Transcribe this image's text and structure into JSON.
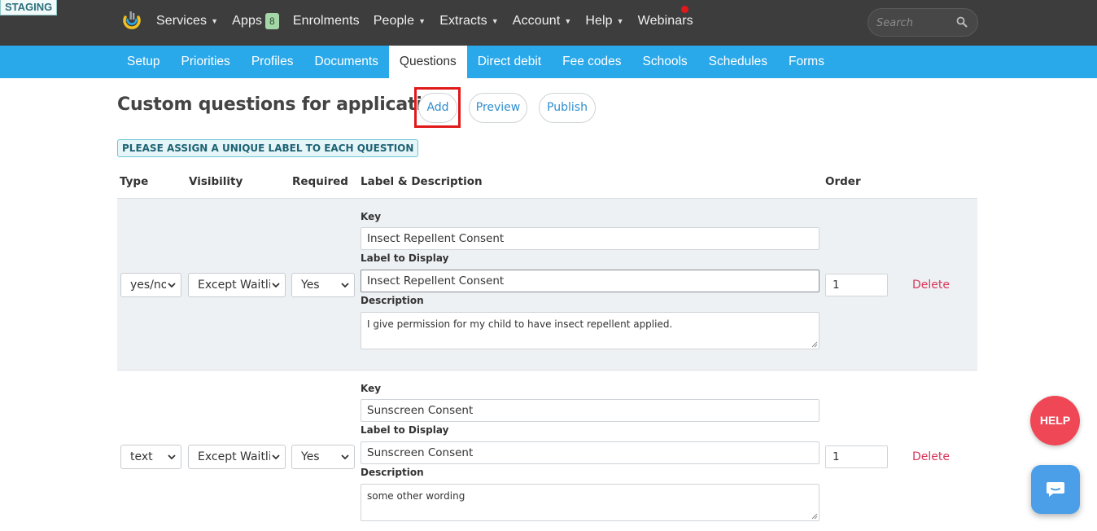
{
  "env_badge": "STAGING",
  "topnav": {
    "items": [
      {
        "label": "Services",
        "caret": true
      },
      {
        "label": "Apps",
        "caret": false,
        "badge": "8"
      },
      {
        "label": "Enrolments",
        "caret": false
      },
      {
        "label": "People",
        "caret": true
      },
      {
        "label": "Extracts",
        "caret": true
      },
      {
        "label": "Account",
        "caret": true
      },
      {
        "label": "Help",
        "caret": true
      },
      {
        "label": "Webinars",
        "caret": false
      }
    ],
    "search_placeholder": "Search"
  },
  "subnav": {
    "tabs": [
      "Setup",
      "Priorities",
      "Profiles",
      "Documents",
      "Questions",
      "Direct debit",
      "Fee codes",
      "Schools",
      "Schedules",
      "Forms"
    ],
    "active": "Questions"
  },
  "header": {
    "title": "Custom questions for application",
    "add_label": "Add",
    "preview_label": "Preview",
    "publish_label": "Publish"
  },
  "notice": "PLEASE ASSIGN A UNIQUE LABEL TO EACH QUESTION",
  "table": {
    "columns": {
      "type": "Type",
      "visibility": "Visibility",
      "required": "Required",
      "label_desc": "Label & Description",
      "order": "Order"
    },
    "field_labels": {
      "key": "Key",
      "label_to_display": "Label to Display",
      "description": "Description"
    },
    "rows": [
      {
        "type": "yes/no",
        "visibility": "Except Waitlist",
        "required": "Yes",
        "key": "Insect Repellent Consent",
        "label": "Insect Repellent Consent",
        "description": "I give permission for my child to have insect repellent applied.",
        "order": "1",
        "delete_label": "Delete"
      },
      {
        "type": "text",
        "visibility": "Except Waitlist",
        "required": "Yes",
        "key": "Sunscreen Consent",
        "label": "Sunscreen Consent",
        "description": "some other wording",
        "order": "1",
        "delete_label": "Delete"
      }
    ]
  },
  "floating": {
    "help_label": "HELP"
  },
  "colors": {
    "topbar": "#3d3d3d",
    "subnav": "#29a8ea",
    "delete": "#d8365a",
    "highlight": "#e0191b",
    "help_fab": "#ef4755",
    "chat_fab": "#4a9fe8"
  }
}
